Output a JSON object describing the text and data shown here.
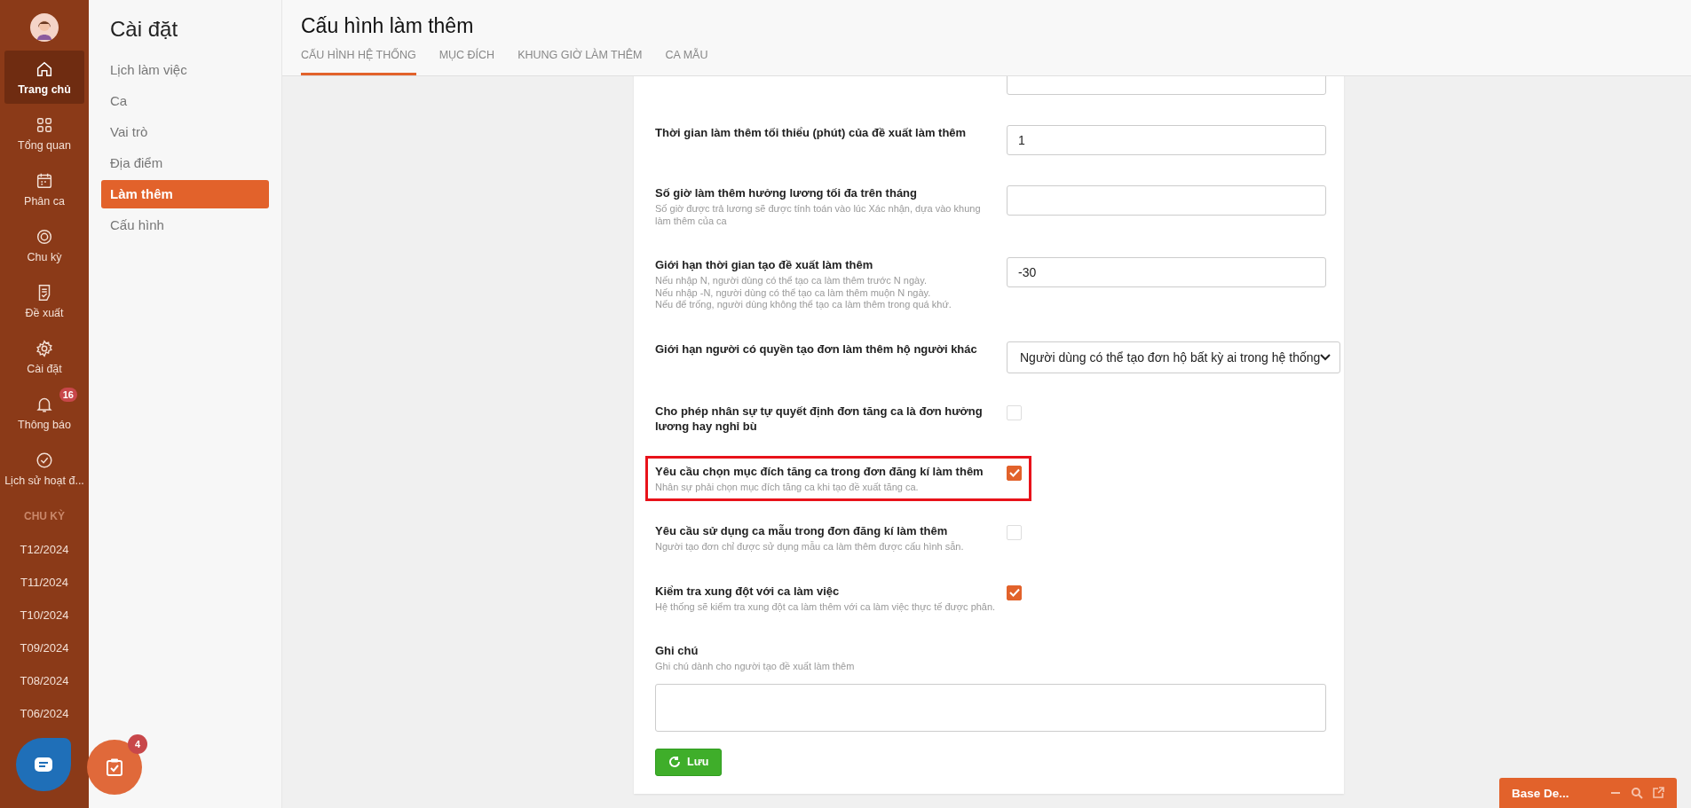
{
  "rail": {
    "items": [
      {
        "label": "Trang chủ",
        "selected": true
      },
      {
        "label": "Tổng quan",
        "selected": false
      },
      {
        "label": "Phân ca",
        "selected": false
      },
      {
        "label": "Chu kỳ",
        "selected": false
      },
      {
        "label": "Đề xuất",
        "selected": false
      },
      {
        "label": "Cài đặt",
        "selected": false
      },
      {
        "label": "Thông báo",
        "selected": false,
        "badge": "16"
      },
      {
        "label": "Lịch sử hoạt đ...",
        "selected": false
      }
    ],
    "section": "CHU KỲ",
    "periods": [
      "T12/2024",
      "T11/2024",
      "T10/2024",
      "T09/2024",
      "T08/2024",
      "T06/2024"
    ]
  },
  "settings": {
    "title": "Cài đặt",
    "items": [
      {
        "label": "Lịch làm việc",
        "selected": false
      },
      {
        "label": "Ca",
        "selected": false
      },
      {
        "label": "Vai trò",
        "selected": false
      },
      {
        "label": "Địa điểm",
        "selected": false
      },
      {
        "label": "Làm thêm",
        "selected": true
      },
      {
        "label": "Cấu hình",
        "selected": false
      }
    ]
  },
  "page": {
    "title": "Cấu hình làm thêm",
    "tabs": [
      {
        "label": "CẤU HÌNH HỆ THỐNG",
        "selected": true
      },
      {
        "label": "MỤC ĐÍCH",
        "selected": false
      },
      {
        "label": "KHUNG GIỜ LÀM THÊM",
        "selected": false
      },
      {
        "label": "CA MẪU",
        "selected": false
      }
    ]
  },
  "form": {
    "rows": [
      {
        "kind": "input"
      },
      {
        "kind": "input",
        "label": "Thời gian làm thêm tối thiểu (phút) của đề xuất làm thêm",
        "value": "1"
      },
      {
        "kind": "input",
        "label": "Số giờ làm thêm hưởng lương tối đa trên tháng",
        "hint": "Số giờ được trả lương sẽ được tính toán vào lúc Xác nhận, dựa vào khung làm thêm của ca"
      },
      {
        "kind": "input",
        "label": "Giới hạn thời gian tạo đề xuất làm thêm",
        "hint": "Nếu nhập N, người dùng có thể tạo ca làm thêm trước N ngày.\nNếu nhập -N, người dùng có thể tạo ca làm thêm muộn N ngày.\nNếu để trống, người dùng không thể tạo ca làm thêm trong quá khứ.",
        "value": "-30"
      },
      {
        "kind": "select",
        "label": "Giới hạn người có quyền tạo đơn làm thêm hộ người khác",
        "value": "Người dùng có thể tạo đơn hộ bất kỳ ai trong hệ thống"
      },
      {
        "kind": "checkbox",
        "label": "Cho phép nhân sự tự quyết định đơn tăng ca là đơn hưởng lương hay nghỉ bù",
        "checked": false,
        "highlighted": false
      },
      {
        "kind": "checkbox",
        "label": "Yêu cầu chọn mục đích tăng ca trong đơn đăng kí làm thêm",
        "hint": "Nhân sự phải chọn mục đích tăng ca khi tạo đề xuất tăng ca.",
        "checked": true,
        "highlighted": true
      },
      {
        "kind": "checkbox",
        "label": "Yêu cầu sử dụng ca mẫu trong đơn đăng kí làm thêm",
        "hint": "Người tạo đơn chỉ được sử dụng mẫu ca làm thêm được cấu hình sẵn.",
        "checked": false,
        "highlighted": false
      },
      {
        "kind": "checkbox",
        "label": "Kiểm tra xung đột với ca làm việc",
        "hint": "Hệ thống sẽ kiểm tra xung đột ca làm thêm với ca làm việc thực tế được phân.",
        "checked": true,
        "highlighted": false
      },
      {
        "kind": "textarea",
        "label": "Ghi chú",
        "hint": "Ghi chú dành cho người tạo đề xuất làm thêm"
      }
    ],
    "save": "Lưu"
  },
  "float": {
    "task_badge": "4"
  },
  "chat_widget": {
    "title": "Base De..."
  }
}
